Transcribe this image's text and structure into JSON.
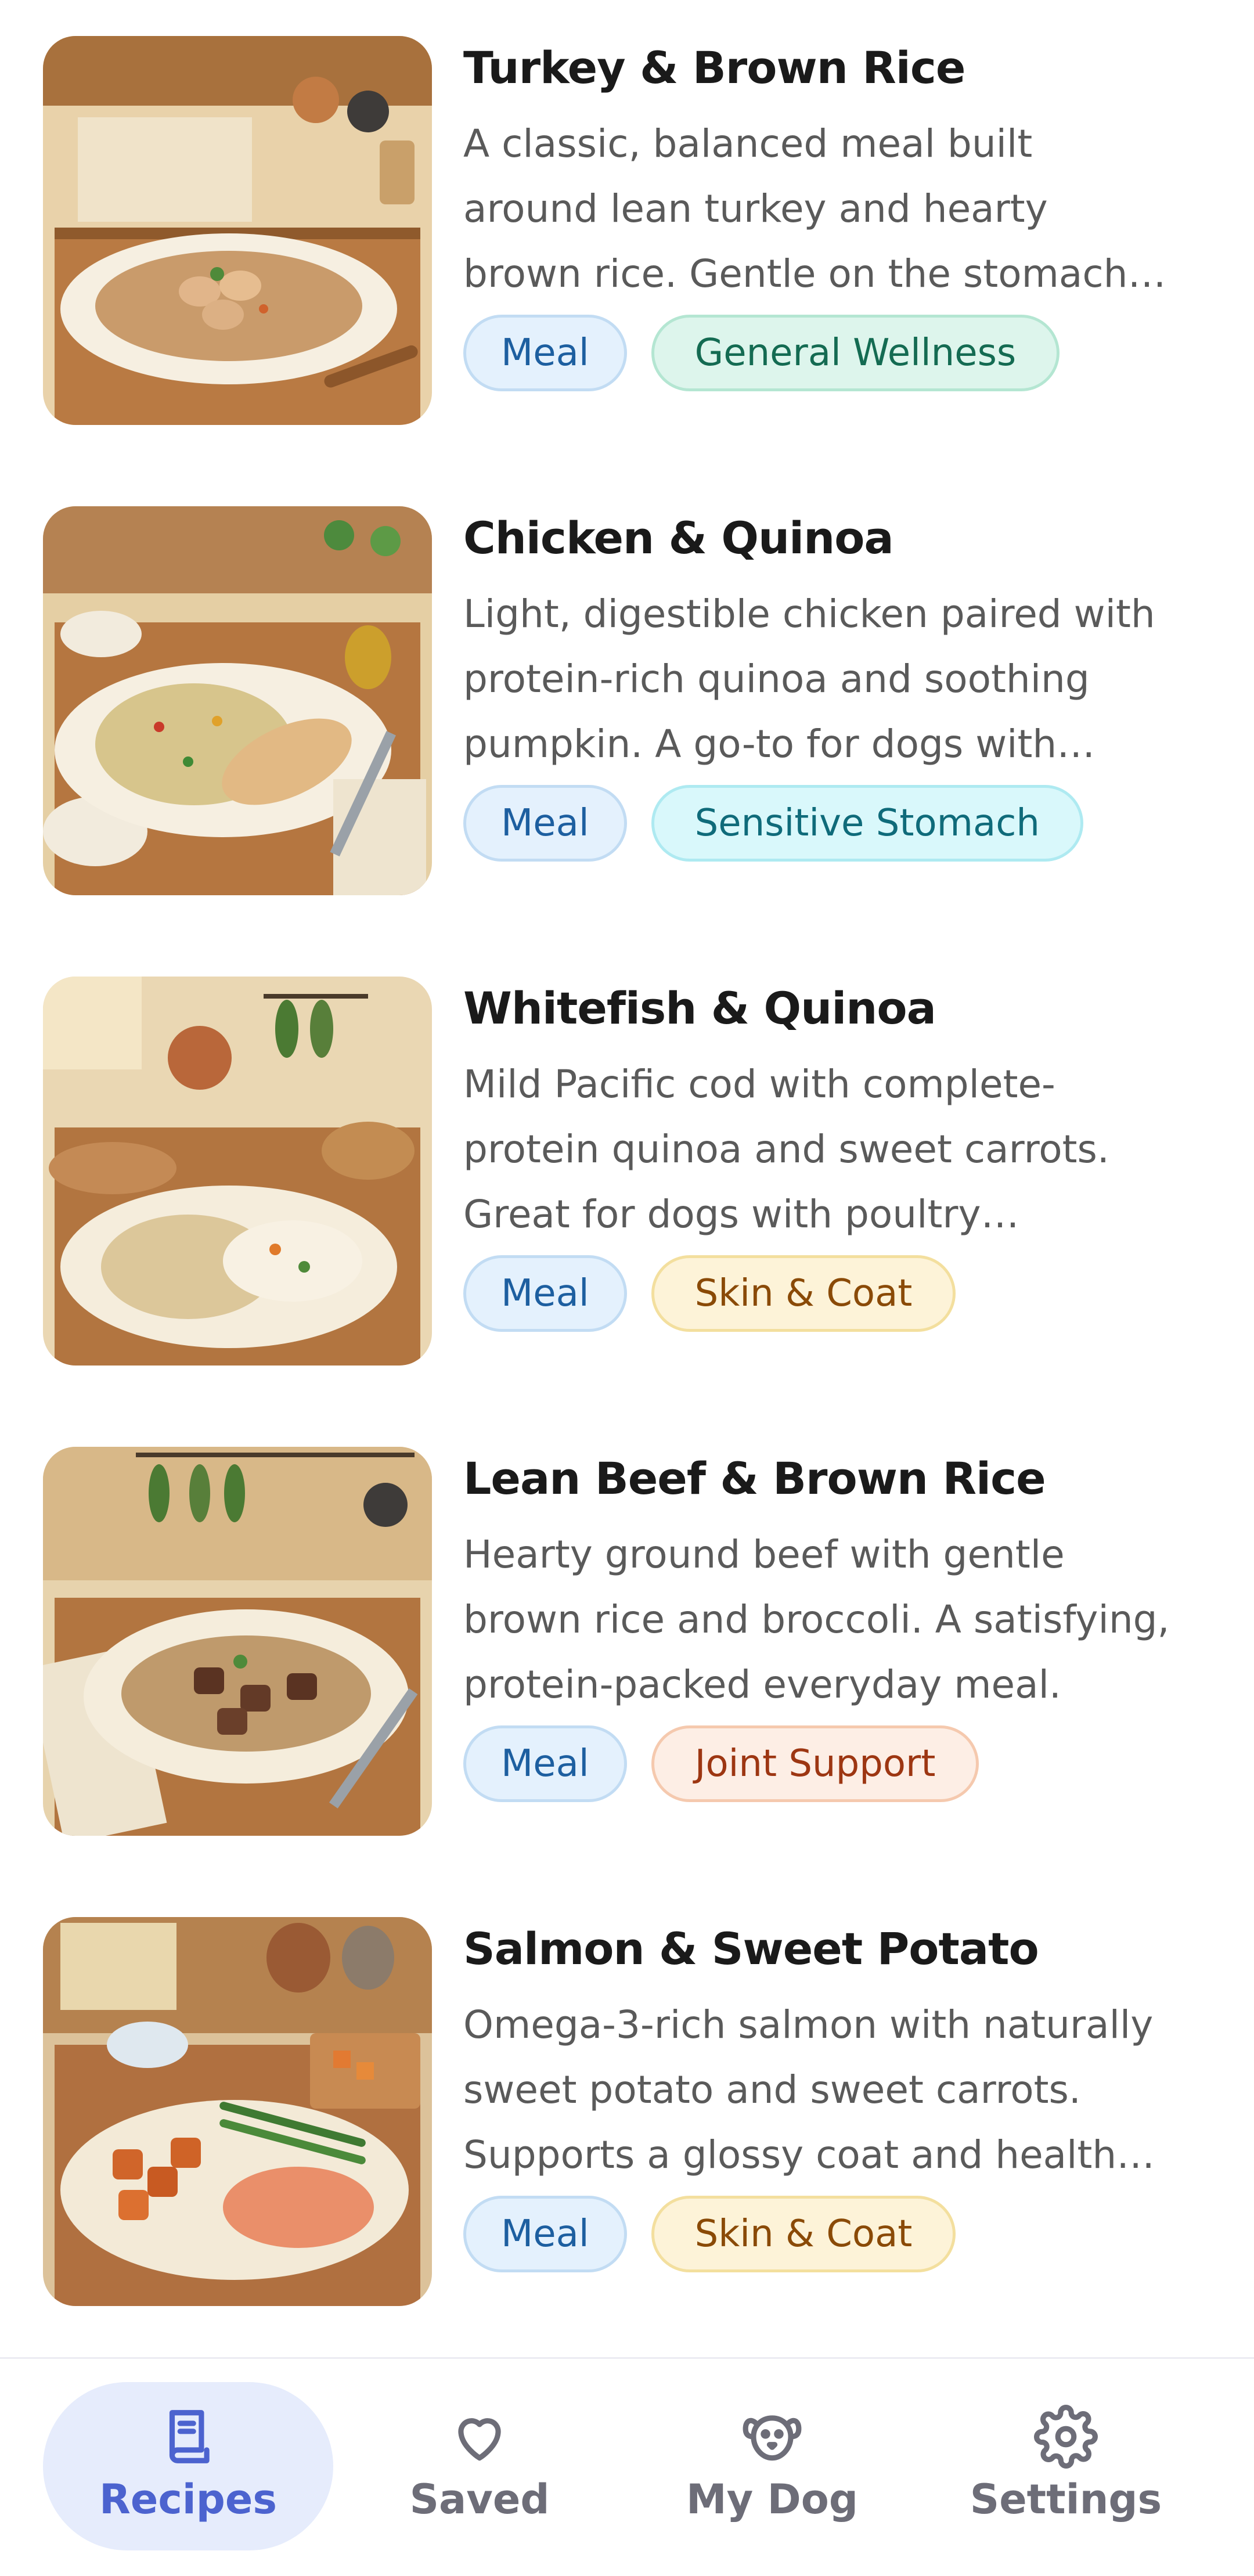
{
  "recipes": [
    {
      "title": "Turkey & Brown Rice",
      "description": "A classic, balanced meal built around lean turkey and hearty brown rice. Gentle on the stomach and perfect for everyday feeding.",
      "tags": [
        {
          "label": "Meal",
          "kind": "meal"
        },
        {
          "label": "General Wellness",
          "kind": "wellness"
        }
      ],
      "image_subject": "turkey-brown-rice-illustration"
    },
    {
      "title": "Chicken & Quinoa",
      "description": "Light, digestible chicken paired with protein-rich quinoa and soothing pumpkin. A go-to for dogs with sensitive stomachs.",
      "tags": [
        {
          "label": "Meal",
          "kind": "meal"
        },
        {
          "label": "Sensitive Stomach",
          "kind": "sensitive"
        }
      ],
      "image_subject": "chicken-quinoa-illustration"
    },
    {
      "title": "Whitefish & Quinoa",
      "description": "Mild Pacific cod with complete-protein quinoa and sweet carrots. Great for dogs with poultry sensitivities.",
      "tags": [
        {
          "label": "Meal",
          "kind": "meal"
        },
        {
          "label": "Skin & Coat",
          "kind": "skin"
        }
      ],
      "image_subject": "whitefish-quinoa-illustration"
    },
    {
      "title": "Lean Beef & Brown Rice",
      "description": "Hearty ground beef with gentle brown rice and broccoli. A satisfying, protein-packed everyday meal.",
      "tags": [
        {
          "label": "Meal",
          "kind": "meal"
        },
        {
          "label": "Joint Support",
          "kind": "joint"
        }
      ],
      "image_subject": "beef-brown-rice-illustration"
    },
    {
      "title": "Salmon & Sweet Potato",
      "description": "Omega-3-rich salmon with naturally sweet potato and sweet carrots. Supports a glossy coat and healthy joints.",
      "tags": [
        {
          "label": "Meal",
          "kind": "meal"
        },
        {
          "label": "Skin & Coat",
          "kind": "skin"
        }
      ],
      "image_subject": "salmon-sweet-potato-illustration"
    }
  ],
  "nav": {
    "items": [
      {
        "label": "Recipes",
        "icon": "recipe-book-icon",
        "active": true
      },
      {
        "label": "Saved",
        "icon": "heart-icon",
        "active": false
      },
      {
        "label": "My Dog",
        "icon": "dog-face-icon",
        "active": false
      },
      {
        "label": "Settings",
        "icon": "gear-icon",
        "active": false
      }
    ]
  },
  "colors": {
    "accent": "#4c63cf",
    "active_nav_bg": "#e6ecfc",
    "title": "#1a1a1a",
    "description": "#5a5a5a"
  }
}
